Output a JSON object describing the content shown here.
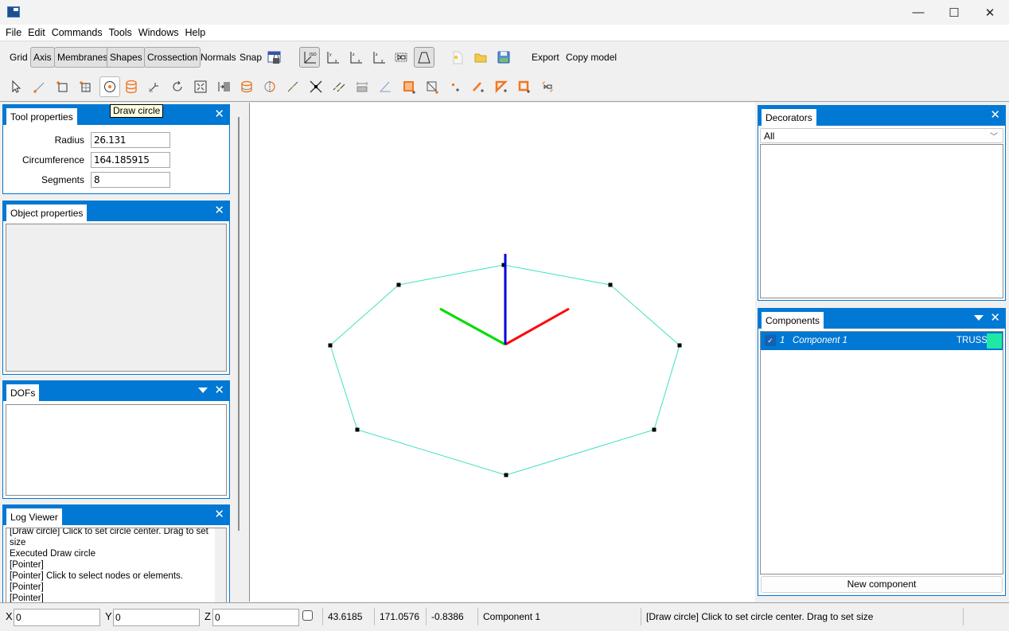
{
  "window": {
    "controls": {
      "minimize": "—",
      "maximize": "☐",
      "close": "✕"
    }
  },
  "menu": [
    "File",
    "Edit",
    "Commands",
    "Tools",
    "Windows",
    "Help"
  ],
  "toolbar1": {
    "toggles": [
      {
        "label": "Grid",
        "pressed": false
      },
      {
        "label": "Axis",
        "pressed": true
      },
      {
        "label": "Membranes",
        "pressed": true
      },
      {
        "label": "Shapes",
        "pressed": true
      },
      {
        "label": "Crossection",
        "pressed": true
      },
      {
        "label": "Normals",
        "pressed": false
      },
      {
        "label": "Snap",
        "pressed": false
      }
    ],
    "view_icons": [
      "lock-view-icon",
      "view-iso-icon",
      "view-xy-icon",
      "view-xz-icon",
      "view-yz-icon",
      "zoom-fit-icon",
      "perspective-icon"
    ],
    "file_icons": [
      "new-file-icon",
      "open-folder-icon",
      "save-icon"
    ],
    "export_label": "Export",
    "copy_model_label": "Copy model"
  },
  "toolbar2": {
    "tools": [
      "pointer",
      "draw-line",
      "draw-rectangle",
      "draw-grid",
      "draw-circle",
      "draw-cylinder",
      "move",
      "rotate",
      "scale",
      "array",
      "crossection",
      "split",
      "line-segment",
      "intersect",
      "parallel",
      "dimension",
      "angle",
      "add-shell",
      "add-rect-node",
      "add-node",
      "add-line",
      "add-triangle",
      "add-quad",
      "select-region"
    ],
    "active_tool": "draw-circle"
  },
  "tooltip": "Draw circle",
  "tool_properties": {
    "title": "Tool properties",
    "fields": [
      {
        "label": "Radius",
        "value": "26.131"
      },
      {
        "label": "Circumference",
        "value": "164.185915"
      },
      {
        "label": "Segments",
        "value": "8"
      }
    ]
  },
  "object_properties": {
    "title": "Object properties"
  },
  "dofs": {
    "title": "DOFs"
  },
  "log_viewer": {
    "title": "Log Viewer",
    "lines": [
      "[Draw circle] Click to set circle center. Drag to set",
      "size",
      "Executed Draw circle",
      "[Pointer]",
      "[Pointer] Click to select nodes or elements.",
      "[Pointer]",
      "[Pointer]"
    ]
  },
  "decorators": {
    "title": "Decorators",
    "filter_selected": "All"
  },
  "components": {
    "title": "Components",
    "items": [
      {
        "checked": true,
        "index": "1",
        "name": "Component 1",
        "type": "TRUSS",
        "color": "#1de9a5"
      }
    ],
    "new_button": "New component"
  },
  "viewport": {
    "shape": "octagon (circle, 8 segments)",
    "shape_color": "#40e0c0",
    "axis_colors": {
      "x": "#ff0000",
      "y": "#00dd00",
      "z": "#0000dd"
    }
  },
  "statusbar": {
    "x_label": "X",
    "x_value": "0",
    "y_label": "Y",
    "y_value": "0",
    "z_label": "Z",
    "z_value": "0",
    "coord1": "43.6185",
    "coord2": "171.0576",
    "coord3": "-0.8386",
    "component": "Component 1",
    "message": "[Draw circle] Click to set circle center. Drag to set size"
  }
}
